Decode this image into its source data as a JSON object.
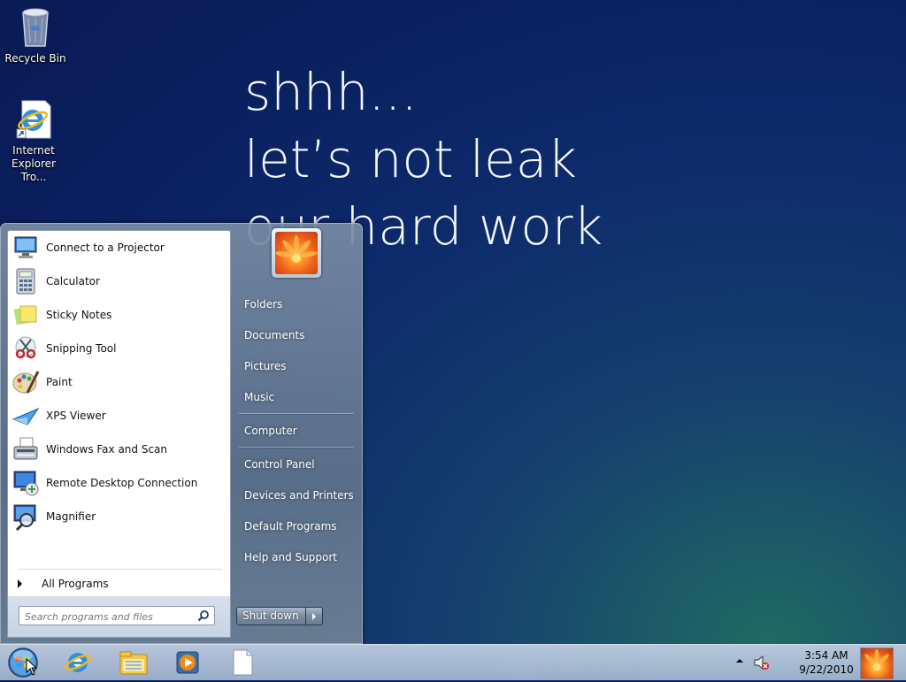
{
  "wallpaper": {
    "lines": [
      "shhh...",
      "let’s not leak",
      "our hard work"
    ]
  },
  "desktop_icons": [
    {
      "label": "Recycle Bin",
      "icon": "recycle-bin-icon"
    },
    {
      "label_line1": "Internet",
      "label_line2": "Explorer Tro...",
      "icon": "internet-explorer-shortcut-icon"
    }
  ],
  "start_menu": {
    "programs": [
      {
        "label": "Connect to a Projector",
        "icon": "projector-icon"
      },
      {
        "label": "Calculator",
        "icon": "calculator-icon"
      },
      {
        "label": "Sticky Notes",
        "icon": "sticky-notes-icon"
      },
      {
        "label": "Snipping Tool",
        "icon": "scissors-icon"
      },
      {
        "label": "Paint",
        "icon": "paint-palette-icon"
      },
      {
        "label": "XPS Viewer",
        "icon": "xps-viewer-icon"
      },
      {
        "label": "Windows Fax and Scan",
        "icon": "fax-icon"
      },
      {
        "label": "Remote Desktop Connection",
        "icon": "remote-desktop-icon"
      },
      {
        "label": "Magnifier",
        "icon": "magnifier-icon"
      }
    ],
    "all_programs": "All Programs",
    "search_placeholder": "Search programs and files",
    "right_links": [
      {
        "label": "Folders"
      },
      {
        "label": "Documents"
      },
      {
        "label": "Pictures"
      },
      {
        "label": "Music"
      },
      {
        "label": "Computer"
      },
      {
        "label": "Control Panel"
      },
      {
        "label": "Devices and Printers"
      },
      {
        "label": "Default Programs"
      },
      {
        "label": "Help and Support"
      }
    ],
    "shutdown_label": "Shut down"
  },
  "taskbar": {
    "pinned": [
      "internet-explorer-icon",
      "windows-explorer-icon",
      "media-player-icon",
      "blank-document-icon"
    ],
    "time": "3:54 AM",
    "date": "9/22/2010"
  },
  "colors": {
    "accent": "#0d2a6a",
    "taskbar": "#b4c5da"
  }
}
